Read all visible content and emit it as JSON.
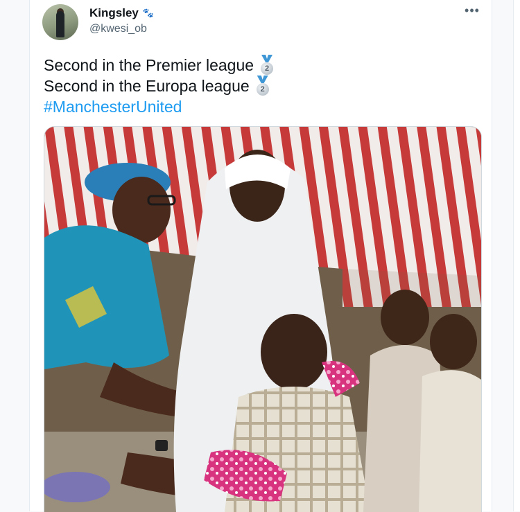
{
  "user": {
    "name": "Kingsley",
    "handle": "@kwesi_ob",
    "name_emoji": "🐾"
  },
  "menu": {
    "more_label": "•••"
  },
  "tweet": {
    "line1": "Second in the Premier league",
    "line2": "Second in the Europa league",
    "hashtag": "#ManchesterUnited",
    "medal_number": "2"
  },
  "colors": {
    "link": "#1d9bf0",
    "text": "#0f1419",
    "secondary": "#536471"
  },
  "icons": [
    "avatar",
    "paw-prints-icon",
    "more-options-icon",
    "second-place-medal-icon"
  ]
}
